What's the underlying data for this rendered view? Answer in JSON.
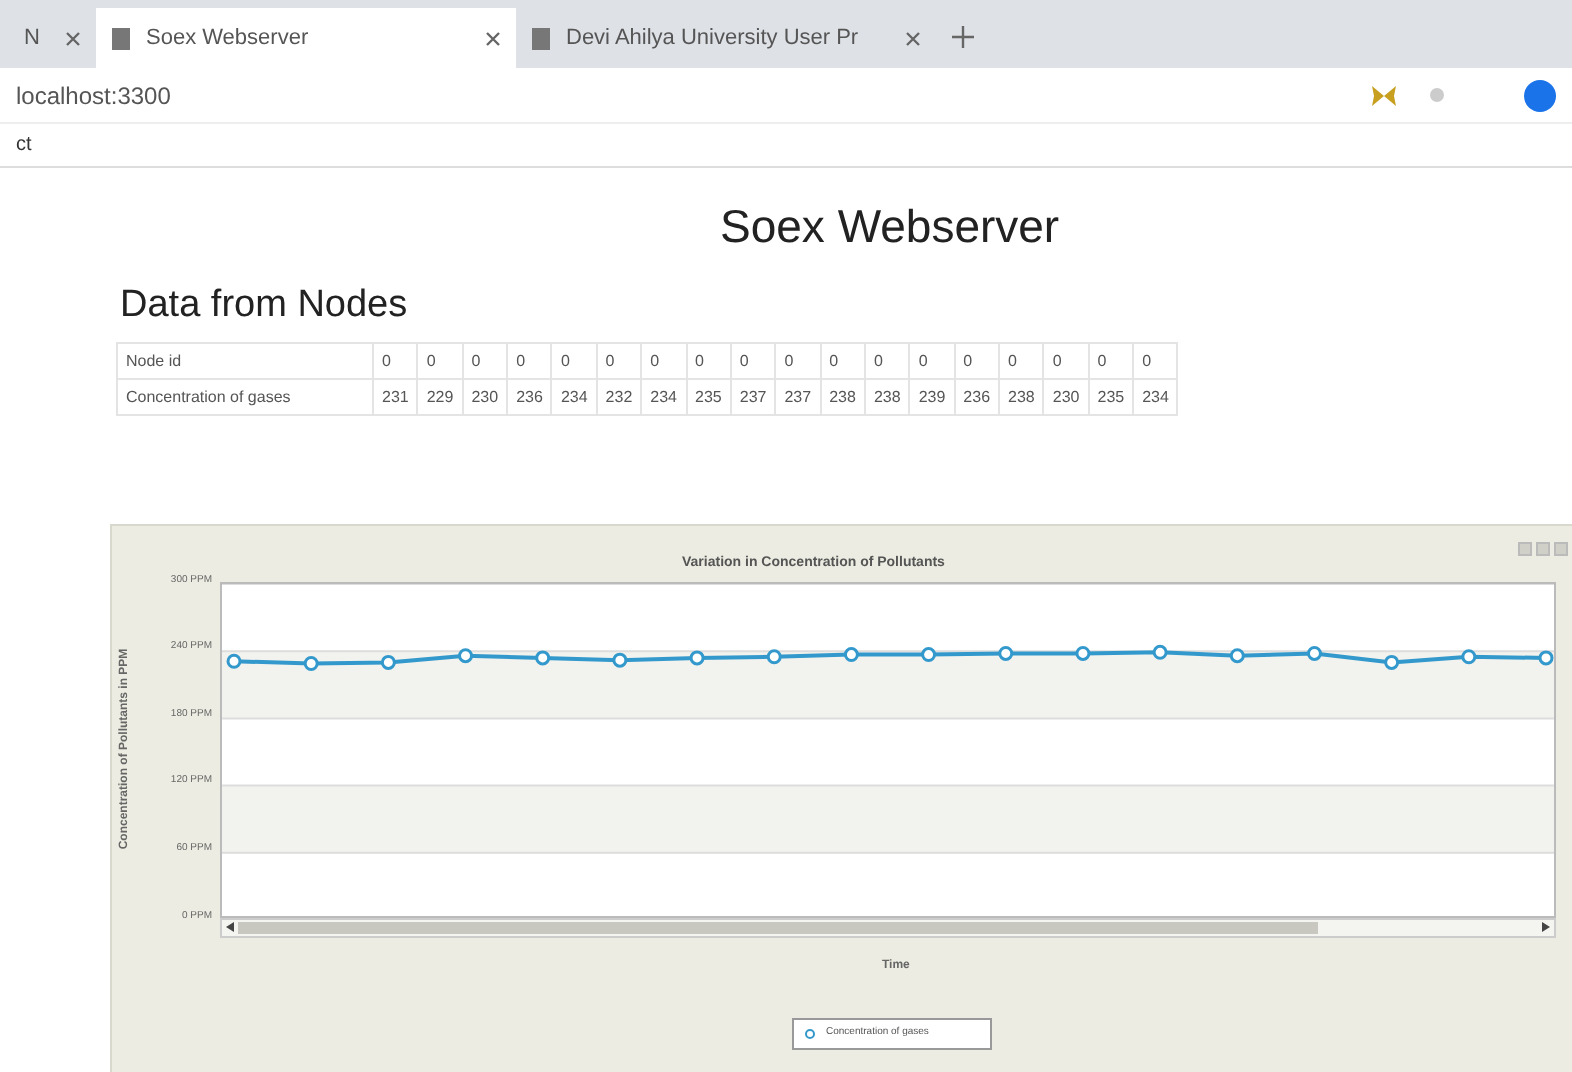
{
  "browser": {
    "tabs": [
      {
        "label": "N",
        "selected": false
      },
      {
        "label": "Soex Webserver",
        "selected": true
      },
      {
        "label": "Devi Ahilya University User Pr",
        "selected": false
      }
    ],
    "address": "localhost:3300",
    "bookmark": "ct"
  },
  "page": {
    "title": "Soex Webserver",
    "heading": "Data from Nodes"
  },
  "table": {
    "rows": [
      {
        "label": "Node id",
        "cells": [
          "0",
          "0",
          "0",
          "0",
          "0",
          "0",
          "0",
          "0",
          "0",
          "0",
          "0",
          "0",
          "0",
          "0",
          "0",
          "0",
          "0",
          "0"
        ]
      },
      {
        "label": "Concentration of gases",
        "cells": [
          "231",
          "229",
          "230",
          "236",
          "234",
          "232",
          "234",
          "235",
          "237",
          "237",
          "238",
          "238",
          "239",
          "236",
          "238",
          "230",
          "235",
          "234"
        ]
      }
    ]
  },
  "chart": {
    "chart_data": {
      "type": "line",
      "title": "Variation in Concentration of Pollutants",
      "xlabel": "Time",
      "ylabel": "Concentration of Pollutants in PPM",
      "ylim": [
        0,
        300
      ],
      "yticks": [
        {
          "value": 0,
          "label": "0 PPM"
        },
        {
          "value": 60,
          "label": "60 PPM"
        },
        {
          "value": 120,
          "label": "120 PPM"
        },
        {
          "value": 180,
          "label": "180 PPM"
        },
        {
          "value": 240,
          "label": "240 PPM"
        },
        {
          "value": 300,
          "label": "300 PPM"
        }
      ],
      "grid": true,
      "series": [
        {
          "name": "Concentration of gases",
          "color": "#3399cc",
          "marker": true,
          "values": [
            231,
            229,
            230,
            236,
            234,
            232,
            234,
            235,
            237,
            237,
            238,
            238,
            239,
            236,
            238,
            230,
            235,
            234
          ]
        }
      ]
    }
  }
}
